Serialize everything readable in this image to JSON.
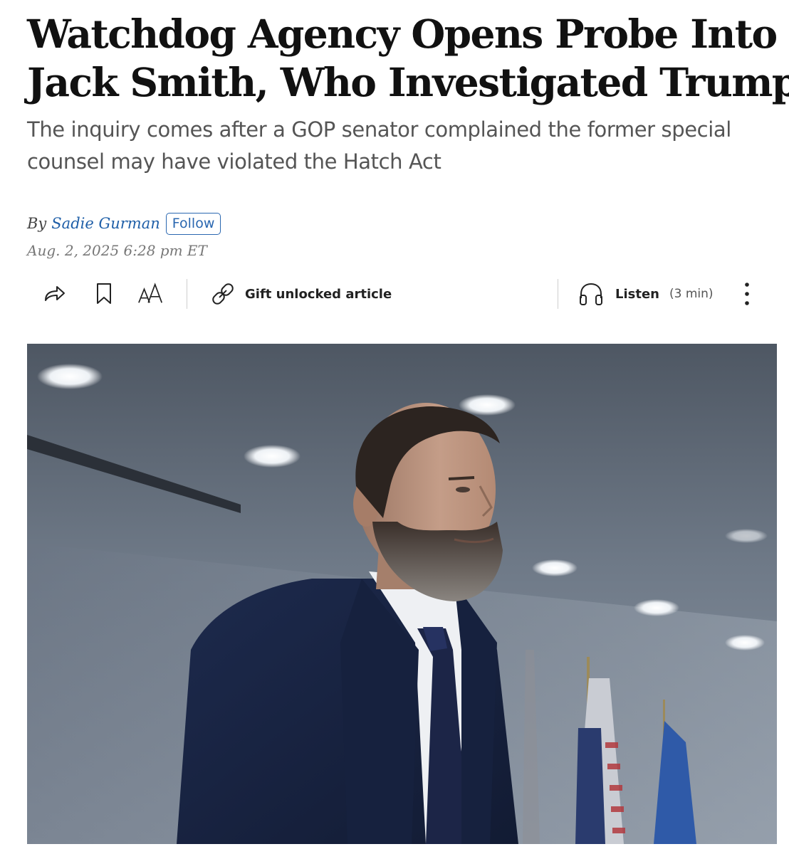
{
  "article": {
    "headline_line1": "Watchdog Agency Opens Probe Into",
    "headline_line2": "Jack Smith, Who Investigated Trump",
    "dek_line1": "The inquiry comes after a GOP senator complained the former special",
    "dek_line2": "counsel may have violated the Hatch Act",
    "byline_prefix": "By",
    "author": "Sadie Gurman",
    "follow_label": "Follow",
    "timestamp": "Aug. 2, 2025 6:28 pm ET"
  },
  "toolbar": {
    "share_icon": "share-arrow-icon",
    "bookmark_icon": "bookmark-icon",
    "text_size_icon": "text-size-icon",
    "gift_icon": "link-icon",
    "gift_label": "Gift unlocked article",
    "listen_icon": "headphones-icon",
    "listen_label": "Listen",
    "listen_duration": "(3 min)",
    "more_icon": "more-vertical-icon"
  },
  "photo": {
    "subject": "man-in-navy-suit-with-beard"
  },
  "colors": {
    "headline": "#111111",
    "dek": "#555555",
    "author_link": "#1f5fa8",
    "follow_border": "#2a67b0",
    "timestamp": "#777777"
  }
}
